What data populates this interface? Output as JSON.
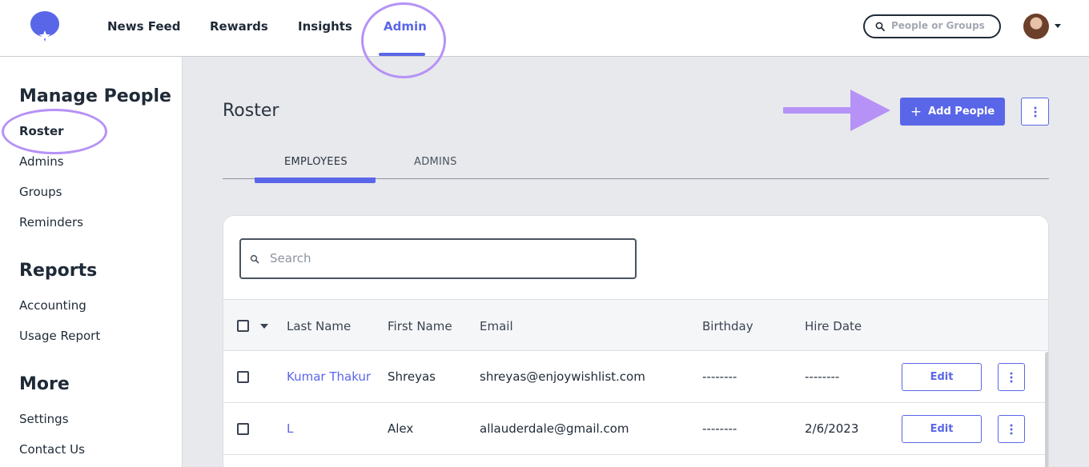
{
  "nav": {
    "items": [
      "News Feed",
      "Rewards",
      "Insights",
      "Admin"
    ],
    "active": "Admin",
    "search_placeholder": "People or Groups"
  },
  "sidebar": {
    "sections": [
      {
        "heading": "Manage People",
        "items": [
          "Roster",
          "Admins",
          "Groups",
          "Reminders"
        ]
      },
      {
        "heading": "Reports",
        "items": [
          "Accounting",
          "Usage Report"
        ]
      },
      {
        "heading": "More",
        "items": [
          "Settings",
          "Contact Us"
        ]
      }
    ],
    "active": "Roster"
  },
  "main": {
    "title": "Roster",
    "add_button_label": "Add People",
    "tabs": [
      "EMPLOYEES",
      "ADMINS"
    ],
    "active_tab": "EMPLOYEES",
    "search_placeholder": "Search"
  },
  "table": {
    "columns": [
      "Last Name",
      "First Name",
      "Email",
      "Birthday",
      "Hire Date"
    ],
    "edit_label": "Edit",
    "rows": [
      {
        "last": "Kumar Thakur",
        "first": "Shreyas",
        "email": "shreyas@enjoywishlist.com",
        "birthday": "--------",
        "hire": "--------"
      },
      {
        "last": "L",
        "first": "Alex",
        "email": "allauderdale@gmail.com",
        "birthday": "--------",
        "hire": "2/6/2023"
      }
    ]
  },
  "colors": {
    "accent": "#5a66e8",
    "highlight": "#b692f6"
  }
}
